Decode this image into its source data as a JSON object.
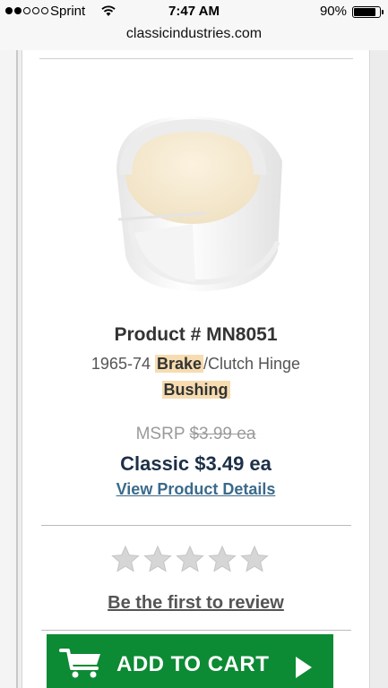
{
  "status_bar": {
    "carrier": "Sprint",
    "time": "7:47 AM",
    "battery_percent": "90%",
    "battery_level": 0.9,
    "signal_bars_full": 2,
    "signal_bars_total": 5,
    "wifi_icon": "wifi-icon"
  },
  "browser": {
    "url": "classicindustries.com"
  },
  "product": {
    "number_label": "Product # MN8051",
    "title_prefix": "1965-74 ",
    "title_highlight_1": "Brake",
    "title_middle": "/Clutch Hinge",
    "title_highlight_2": "Bushing",
    "image_icon": "bushing-image",
    "msrp_label": "MSRP ",
    "msrp_price": "$3.99 ea",
    "classic_price": "Classic $3.49 ea",
    "details_link": "View Product Details"
  },
  "reviews": {
    "rating": 0,
    "max_rating": 5,
    "prompt": "Be the first to review"
  },
  "cart": {
    "button_label": "ADD TO CART",
    "icon": "cart-icon",
    "arrow_icon": "play-icon",
    "color": "#0d8a34"
  }
}
